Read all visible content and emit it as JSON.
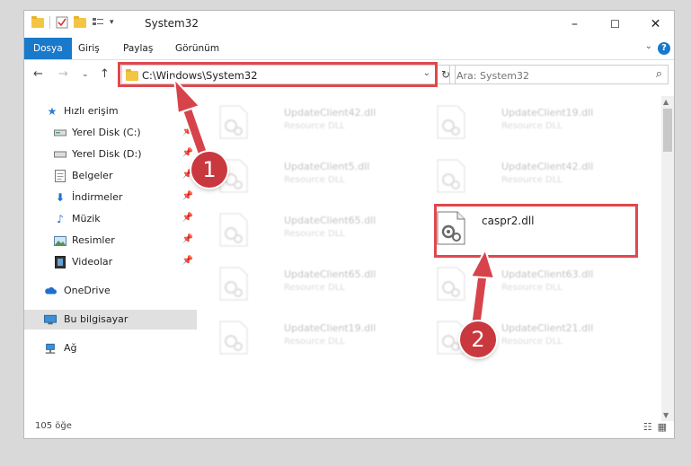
{
  "window": {
    "title": "System32",
    "controls": [
      "–",
      "☐",
      "✕"
    ]
  },
  "ribbon": {
    "tabs": [
      "Dosya",
      "Giriş",
      "Paylaş",
      "Görünüm"
    ]
  },
  "address": {
    "path": "C:\\Windows\\System32",
    "search_placeholder": "Ara: System32"
  },
  "nav": {
    "quick_access": "Hızlı erişim",
    "items": [
      {
        "label": "Yerel Disk (C:)",
        "icon": "drive-icon",
        "pinned": true
      },
      {
        "label": "Yerel Disk (D:)",
        "icon": "drive-icon",
        "pinned": true
      },
      {
        "label": "Belgeler",
        "icon": "documents-icon",
        "pinned": true
      },
      {
        "label": "İndirmeler",
        "icon": "downloads-icon",
        "pinned": true
      },
      {
        "label": "Müzik",
        "icon": "music-icon",
        "pinned": true
      },
      {
        "label": "Resimler",
        "icon": "pictures-icon",
        "pinned": true
      },
      {
        "label": "Videolar",
        "icon": "videos-icon",
        "pinned": true
      }
    ],
    "onedrive": "OneDrive",
    "this_pc": "Bu bilgisayar",
    "network": "Ağ"
  },
  "files": [
    {
      "name": "UpdateClient42.dll",
      "type": "Resource DLL"
    },
    {
      "name": "UpdateClient19.dll",
      "type": "Resource DLL"
    },
    {
      "name": "UpdateClient5.dll",
      "type": "Resource DLL"
    },
    {
      "name": "UpdateClient42.dll",
      "type": "Resource DLL"
    },
    {
      "name": "UpdateClient65.dll",
      "type": "Resource DLL"
    },
    {
      "name": "caspr2.dll",
      "type": ""
    },
    {
      "name": "UpdateClient65.dll",
      "type": "Resource DLL"
    },
    {
      "name": "UpdateClient63.dll",
      "type": "Resource DLL"
    },
    {
      "name": "UpdateClient19.dll",
      "type": "Resource DLL"
    },
    {
      "name": "UpdateClient21.dll",
      "type": "Resource DLL"
    }
  ],
  "status": {
    "count": "105 öğe"
  },
  "annotations": {
    "step1": "1",
    "step2": "2",
    "color": "#e0484e"
  }
}
